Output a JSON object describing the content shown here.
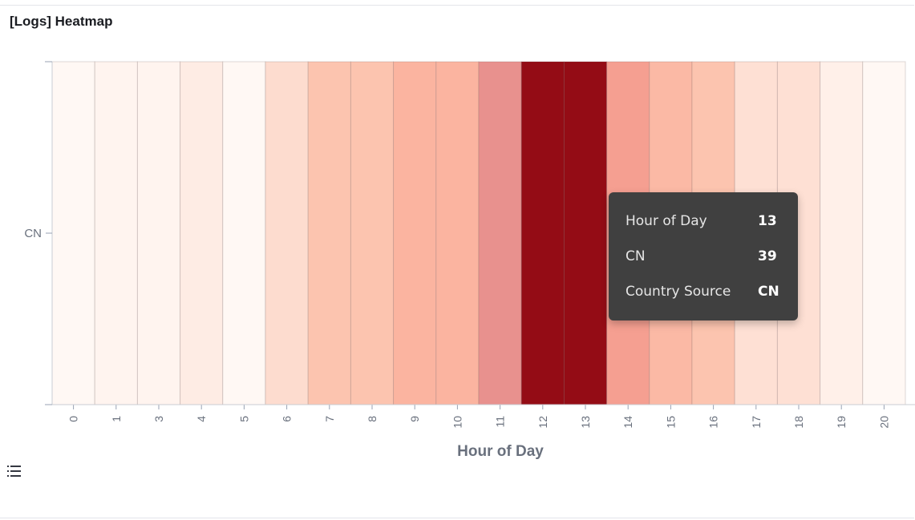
{
  "panel": {
    "title": "[Logs] Heatmap"
  },
  "chart_data": {
    "type": "heatmap",
    "title": "[Logs] Heatmap",
    "xlabel": "Hour of Day",
    "ylabel": "",
    "y_categories": [
      "CN"
    ],
    "x_categories": [
      "0",
      "1",
      "3",
      "4",
      "5",
      "6",
      "7",
      "8",
      "9",
      "10",
      "11",
      "12",
      "13",
      "14",
      "15",
      "16",
      "17",
      "18",
      "19",
      "20"
    ],
    "series": [
      {
        "name": "CN",
        "values": [
          1,
          2,
          2,
          4,
          1,
          8,
          14,
          14,
          17,
          17,
          24,
          39,
          39,
          21,
          16,
          14,
          7,
          7,
          3,
          1
        ]
      }
    ],
    "color_scale": [
      "#fff8f4",
      "#fcc3ad",
      "#f9a392",
      "#e99390",
      "#940c15"
    ],
    "grid": false,
    "legend": "none"
  },
  "tooltip": {
    "rows": [
      {
        "label": "Hour of Day",
        "value": "13"
      },
      {
        "label": "CN",
        "value": "39"
      },
      {
        "label": "Country Source",
        "value": "CN"
      }
    ]
  },
  "legend_toggle": {
    "icon": "list-icon"
  }
}
